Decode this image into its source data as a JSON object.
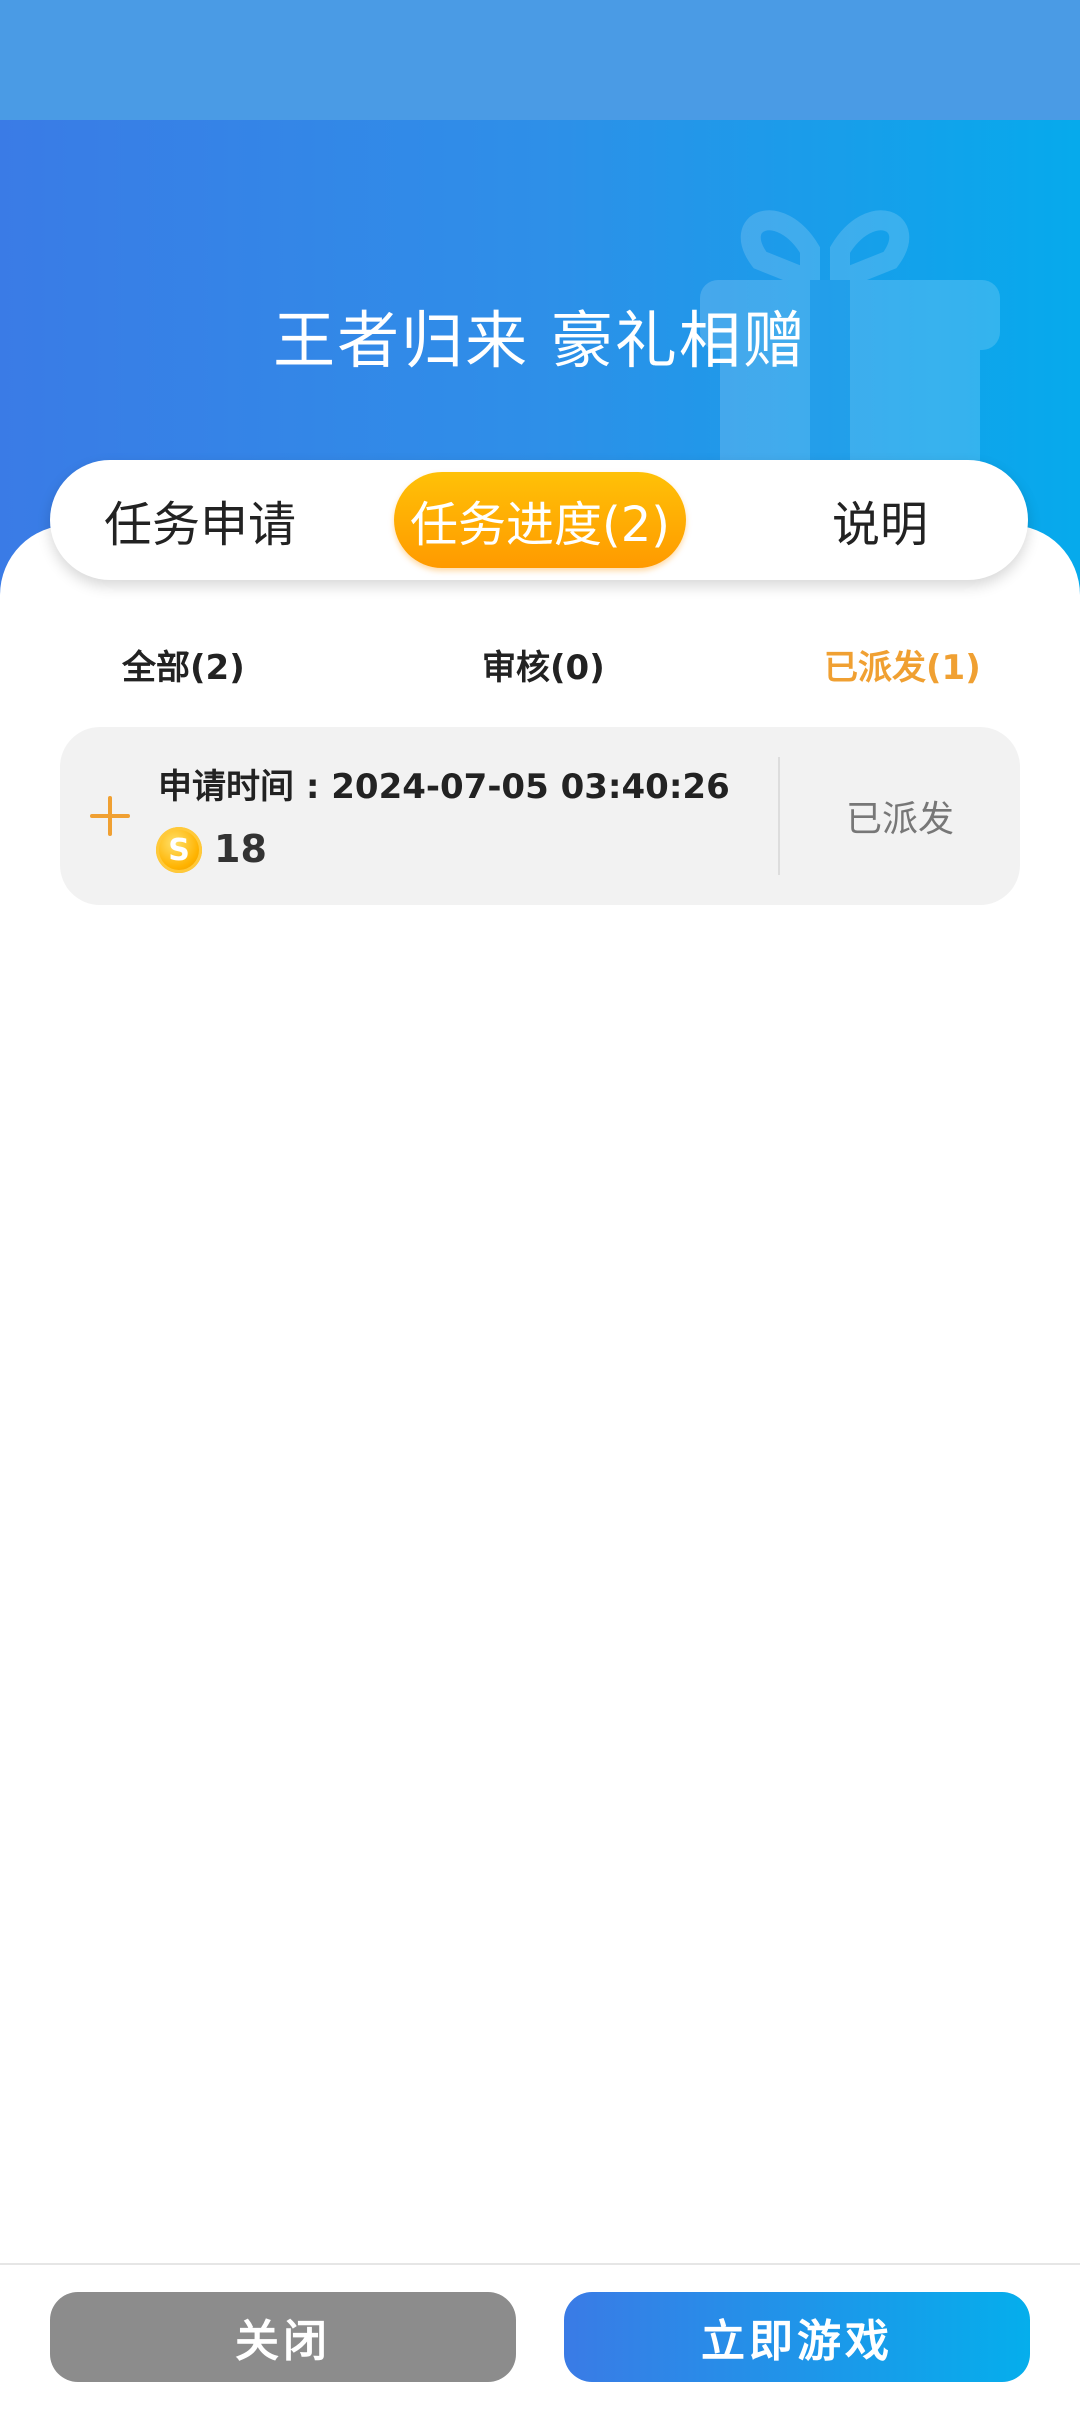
{
  "header": {
    "title": "王者归来 豪礼相赠"
  },
  "tabs": {
    "apply": "任务申请",
    "progress": "任务进度(2)",
    "explain": "说明",
    "active": "progress"
  },
  "filters": {
    "all": "全部(2)",
    "review": "审核(0)",
    "sent": "已派发(1)",
    "active": "sent",
    "active_color": "#F0A032"
  },
  "records": [
    {
      "time_label": "申请时间 : 2024-07-05 03:40:26",
      "coin_symbol": "S",
      "amount": "18",
      "status": "已派发"
    }
  ],
  "footer": {
    "close_label": "关闭",
    "play_label": "立即游戏"
  },
  "colors": {
    "brand_blue": "#3A7BE6",
    "accent_orange": "#FF9A00",
    "close_gray": "#8C8C8C"
  }
}
